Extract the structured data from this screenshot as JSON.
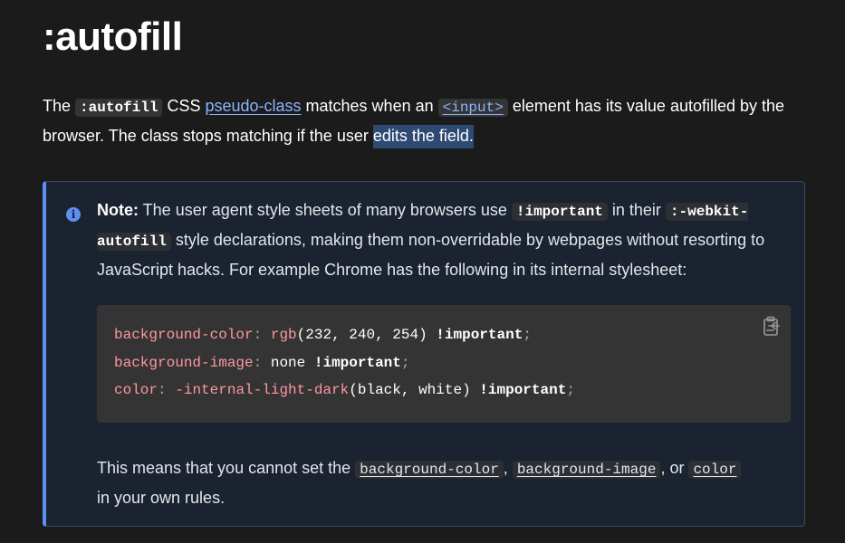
{
  "page": {
    "title": ":autofill"
  },
  "intro": {
    "text_1": "The ",
    "code_autofill": ":autofill",
    "text_2": " CSS ",
    "link_pseudo_class": "pseudo-class",
    "text_3": " matches when an ",
    "link_input": "<input>",
    "text_4": " element has its value autofilled by the browser. The class stops matching if the user ",
    "selected_text": "edits the field."
  },
  "note": {
    "icon": "info-icon",
    "label": "Note:",
    "text_1": " The user agent style sheets of many browsers use ",
    "code_important": "!important",
    "text_2": " in their ",
    "code_webkit_autofill": ":-webkit-autofill",
    "text_3": " style declarations, making them non-overridable by webpages without resorting to JavaScript hacks. For example Chrome has the following in its internal stylesheet:",
    "code_block": {
      "copy_icon": "clipboard-icon",
      "lines": [
        {
          "prop": "background-color",
          "colon": ":",
          "value_fn": "rgb",
          "value_args": "(232, 240, 254)",
          "important": "!important",
          "semi": ";"
        },
        {
          "prop": "background-image",
          "colon": ":",
          "value_plain": "none",
          "important": "!important",
          "semi": ";"
        },
        {
          "prop": "color",
          "colon": ":",
          "value_fn": "-internal-light-dark",
          "value_args": "(black, white)",
          "important": "!important",
          "semi": ";"
        }
      ]
    },
    "after_text_1": "This means that you cannot set the ",
    "link_background_color": "background-color",
    "after_sep_1": ", ",
    "link_background_image": "background-image",
    "after_sep_2": ", or ",
    "link_color": "color",
    "after_text_2": " in your own rules."
  },
  "colors": {
    "background": "#1b1b1b",
    "link": "#8cb4ff",
    "note_background": "#1a232f",
    "note_accent": "#5e8ff5",
    "code_property": "#ff97a0",
    "selection": "#2e4a73"
  }
}
